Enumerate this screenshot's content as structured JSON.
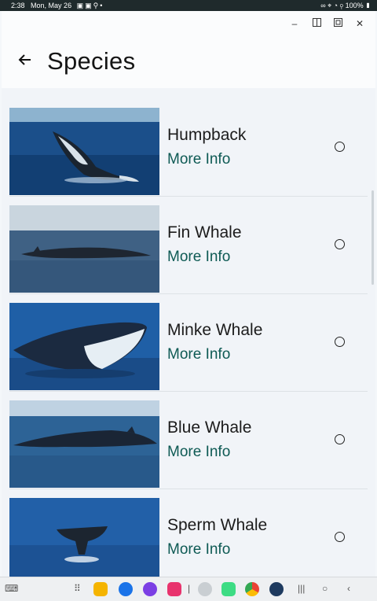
{
  "status_bar": {
    "time": "2:38",
    "date": "Mon, May 26",
    "battery": "100%"
  },
  "window_controls": {
    "minimize_icon": "minimize-icon",
    "split_icon": "split-view-icon",
    "popup_icon": "popup-view-icon",
    "close_icon": "close-icon"
  },
  "header": {
    "title": "Species",
    "back_icon": "arrow-left-icon"
  },
  "species": [
    {
      "name": "Humpback",
      "link": "More Info"
    },
    {
      "name": "Fin Whale",
      "link": "More Info"
    },
    {
      "name": "Minke Whale",
      "link": "More Info"
    },
    {
      "name": "Blue Whale",
      "link": "More Info"
    },
    {
      "name": "Sperm Whale",
      "link": "More Info"
    }
  ],
  "colors": {
    "link": "#0e5a54",
    "ocean_dark": "#0d3f7a",
    "ocean_light": "#2f6ea8"
  }
}
